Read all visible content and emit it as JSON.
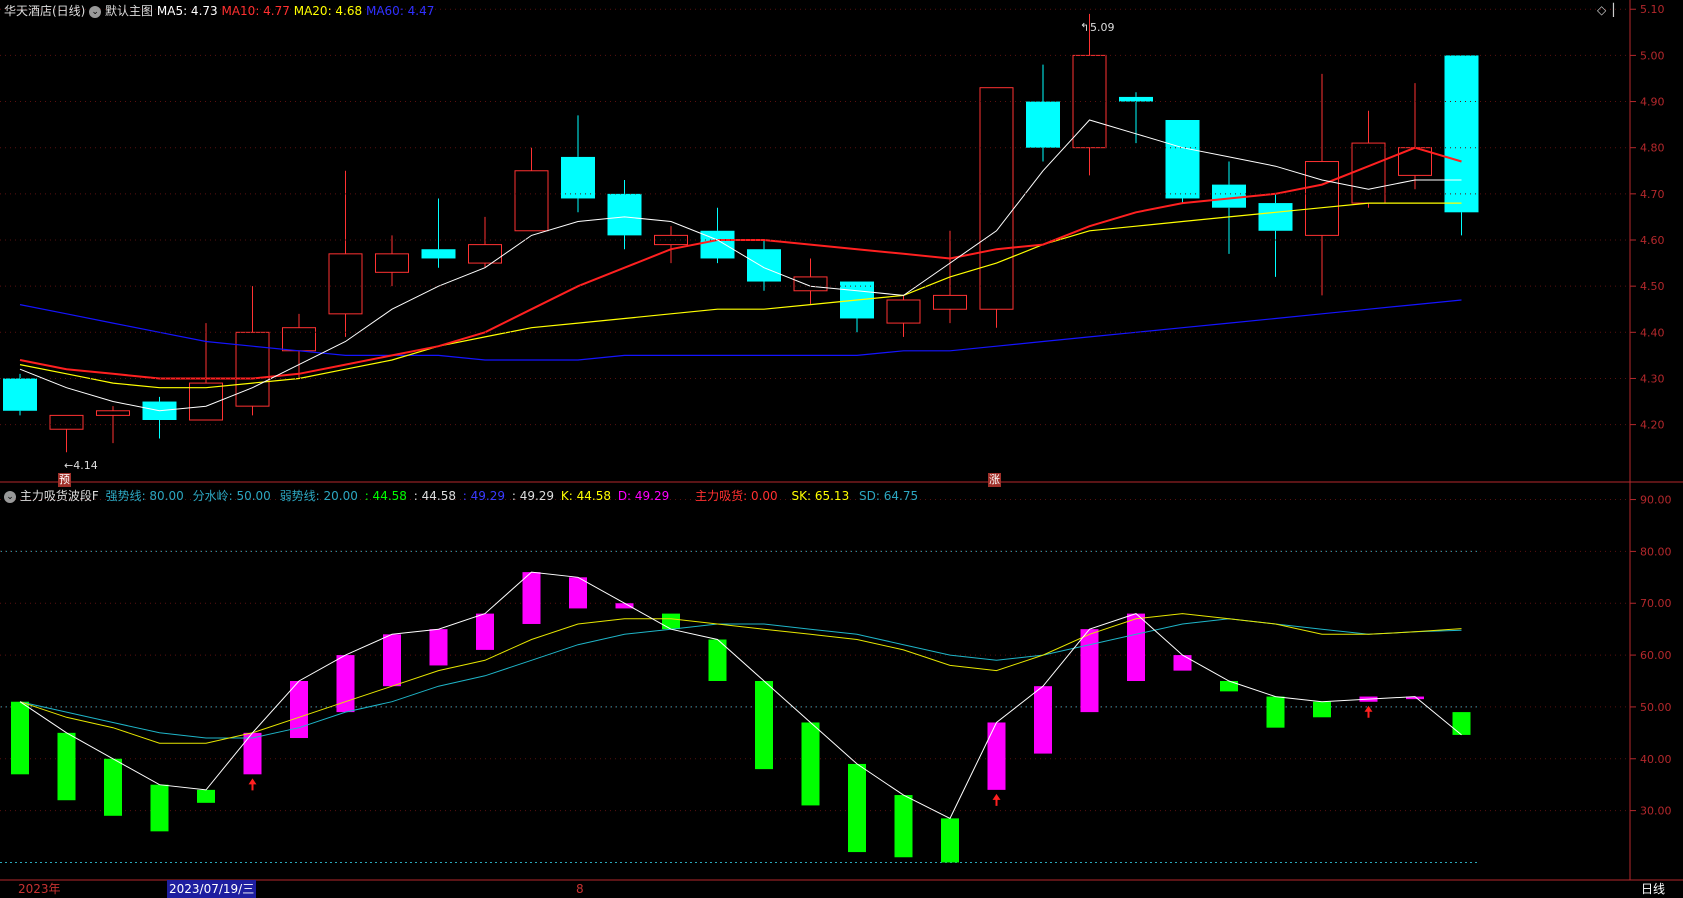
{
  "header_main": {
    "stock_name": "华天酒店(日线)",
    "indicator_name": "默认主图",
    "ma5": "MA5: 4.73",
    "ma10": "MA10: 4.77",
    "ma20": "MA20: 4.68",
    "ma60": "MA60: 4.47"
  },
  "header_sub": {
    "indicator_name": "主力吸货波段F",
    "strong_line": "强势线: 80.00",
    "water_line": "分水岭: 50.00",
    "weak_line": "弱势线: 20.00",
    "v1": ": 44.58",
    "v2": ": 44.58",
    "v3": ": 49.29",
    "v4": ": 49.29",
    "k": "K: 44.58",
    "d": "D: 49.29",
    "absorb": "主力吸货: 0.00",
    "sk": "SK: 65.13",
    "sd": "SD: 64.75"
  },
  "annotations": {
    "high": "5.09",
    "low": "←4.14",
    "pre_badge": "预",
    "rise_badge": "涨",
    "high_mark": "↰"
  },
  "bottom_bar": {
    "year": "2023年",
    "date": "2023/07/19/三",
    "mid_marker": "8",
    "period": "日线"
  },
  "icons": {
    "header_toggle": "chevron-down-icon",
    "settings": "diamond-icon"
  },
  "colors": {
    "up": "#ff3232",
    "down": "#00ffff",
    "ma5": "#ffffff",
    "ma10": "#ff2020",
    "ma20": "#ffff00",
    "ma60": "#1414ff",
    "kd_up": "#ff00ff",
    "kd_down": "#00ff00",
    "axis": "#b4282c",
    "sk": "#e6e600",
    "sd": "#1fb5c8"
  },
  "chart_data": [
    {
      "type": "candlestick",
      "title": "华天酒店(日线)",
      "y_ticks": [
        "5.10",
        "5.00",
        "4.90",
        "4.80",
        "4.70",
        "4.60",
        "4.50",
        "4.40",
        "4.30",
        "4.20"
      ],
      "ylim": [
        4.08,
        5.12
      ],
      "candles": [
        {
          "o": 4.3,
          "h": 4.31,
          "l": 4.22,
          "c": 4.23
        },
        {
          "o": 4.19,
          "h": 4.22,
          "l": 4.14,
          "c": 4.22
        },
        {
          "o": 4.22,
          "h": 4.24,
          "l": 4.16,
          "c": 4.23
        },
        {
          "o": 4.25,
          "h": 4.26,
          "l": 4.17,
          "c": 4.21
        },
        {
          "o": 4.21,
          "h": 4.42,
          "l": 4.21,
          "c": 4.29
        },
        {
          "o": 4.24,
          "h": 4.5,
          "l": 4.22,
          "c": 4.4
        },
        {
          "o": 4.36,
          "h": 4.44,
          "l": 4.3,
          "c": 4.41
        },
        {
          "o": 4.44,
          "h": 4.75,
          "l": 4.39,
          "c": 4.57
        },
        {
          "o": 4.53,
          "h": 4.61,
          "l": 4.5,
          "c": 4.57
        },
        {
          "o": 4.58,
          "h": 4.69,
          "l": 4.54,
          "c": 4.56
        },
        {
          "o": 4.55,
          "h": 4.65,
          "l": 4.54,
          "c": 4.59
        },
        {
          "o": 4.62,
          "h": 4.8,
          "l": 4.62,
          "c": 4.75
        },
        {
          "o": 4.78,
          "h": 4.87,
          "l": 4.66,
          "c": 4.69
        },
        {
          "o": 4.7,
          "h": 4.73,
          "l": 4.58,
          "c": 4.61
        },
        {
          "o": 4.59,
          "h": 4.63,
          "l": 4.55,
          "c": 4.61
        },
        {
          "o": 4.62,
          "h": 4.67,
          "l": 4.55,
          "c": 4.56
        },
        {
          "o": 4.58,
          "h": 4.6,
          "l": 4.49,
          "c": 4.51
        },
        {
          "o": 4.49,
          "h": 4.56,
          "l": 4.46,
          "c": 4.52
        },
        {
          "o": 4.51,
          "h": 4.51,
          "l": 4.4,
          "c": 4.43
        },
        {
          "o": 4.42,
          "h": 4.48,
          "l": 4.39,
          "c": 4.47
        },
        {
          "o": 4.45,
          "h": 4.62,
          "l": 4.42,
          "c": 4.48
        },
        {
          "o": 4.45,
          "h": 4.93,
          "l": 4.41,
          "c": 4.93
        },
        {
          "o": 4.9,
          "h": 4.98,
          "l": 4.77,
          "c": 4.8
        },
        {
          "o": 4.8,
          "h": 5.09,
          "l": 4.74,
          "c": 5.0
        },
        {
          "o": 4.91,
          "h": 4.92,
          "l": 4.81,
          "c": 4.9
        },
        {
          "o": 4.86,
          "h": 4.86,
          "l": 4.68,
          "c": 4.69
        },
        {
          "o": 4.72,
          "h": 4.77,
          "l": 4.57,
          "c": 4.67
        },
        {
          "o": 4.68,
          "h": 4.7,
          "l": 4.52,
          "c": 4.62
        },
        {
          "o": 4.61,
          "h": 4.96,
          "l": 4.48,
          "c": 4.77
        },
        {
          "o": 4.68,
          "h": 4.88,
          "l": 4.67,
          "c": 4.81
        },
        {
          "o": 4.74,
          "h": 4.94,
          "l": 4.71,
          "c": 4.8
        },
        {
          "o": 5.0,
          "h": 5.0,
          "l": 4.61,
          "c": 4.66
        }
      ],
      "ma5": [
        4.32,
        4.28,
        4.25,
        4.23,
        4.24,
        4.28,
        4.33,
        4.38,
        4.45,
        4.5,
        4.54,
        4.61,
        4.64,
        4.65,
        4.64,
        4.6,
        4.54,
        4.5,
        4.49,
        4.48,
        4.55,
        4.62,
        4.75,
        4.86,
        4.83,
        4.8,
        4.78,
        4.76,
        4.73,
        4.71,
        4.73,
        4.73
      ],
      "ma10": [
        4.34,
        4.32,
        4.31,
        4.3,
        4.3,
        4.3,
        4.31,
        4.33,
        4.35,
        4.37,
        4.4,
        4.45,
        4.5,
        4.54,
        4.58,
        4.6,
        4.6,
        4.59,
        4.58,
        4.57,
        4.56,
        4.58,
        4.59,
        4.63,
        4.66,
        4.68,
        4.69,
        4.7,
        4.72,
        4.76,
        4.8,
        4.77
      ],
      "ma20": [
        4.33,
        4.31,
        4.29,
        4.28,
        4.28,
        4.29,
        4.3,
        4.32,
        4.34,
        4.37,
        4.39,
        4.41,
        4.42,
        4.43,
        4.44,
        4.45,
        4.45,
        4.46,
        4.47,
        4.48,
        4.52,
        4.55,
        4.59,
        4.62,
        4.63,
        4.64,
        4.65,
        4.66,
        4.67,
        4.68,
        4.68,
        4.68
      ],
      "ma60": [
        4.46,
        4.44,
        4.42,
        4.4,
        4.38,
        4.37,
        4.36,
        4.35,
        4.35,
        4.35,
        4.34,
        4.34,
        4.34,
        4.35,
        4.35,
        4.35,
        4.35,
        4.35,
        4.35,
        4.36,
        4.36,
        4.37,
        4.38,
        4.39,
        4.4,
        4.41,
        4.42,
        4.43,
        4.44,
        4.45,
        4.46,
        4.47
      ]
    },
    {
      "type": "bar",
      "title": "主力吸货波段F",
      "y_ticks": [
        "90.00",
        "80.00",
        "70.00",
        "60.00",
        "50.00",
        "40.00",
        "30.00"
      ],
      "ylim": [
        17,
        93
      ],
      "reference_lines": [
        80,
        50,
        20
      ],
      "bars": [
        {
          "from": 51,
          "to": 37
        },
        {
          "from": 45,
          "to": 32
        },
        {
          "from": 40,
          "to": 29
        },
        {
          "from": 35,
          "to": 26
        },
        {
          "from": 34,
          "to": 31.5
        },
        {
          "from": 37,
          "to": 45
        },
        {
          "from": 44,
          "to": 55
        },
        {
          "from": 49,
          "to": 60
        },
        {
          "from": 54,
          "to": 64
        },
        {
          "from": 58,
          "to": 65
        },
        {
          "from": 61,
          "to": 68
        },
        {
          "from": 66,
          "to": 76
        },
        {
          "from": 69,
          "to": 75
        },
        {
          "from": 69,
          "to": 70
        },
        {
          "from": 68,
          "to": 65
        },
        {
          "from": 63,
          "to": 55
        },
        {
          "from": 55,
          "to": 38
        },
        {
          "from": 47,
          "to": 31
        },
        {
          "from": 39,
          "to": 22
        },
        {
          "from": 33,
          "to": 21
        },
        {
          "from": 28.5,
          "to": 20
        },
        {
          "from": 34,
          "to": 47
        },
        {
          "from": 41,
          "to": 54
        },
        {
          "from": 49,
          "to": 65
        },
        {
          "from": 55,
          "to": 68
        },
        {
          "from": 57,
          "to": 60
        },
        {
          "from": 55,
          "to": 53
        },
        {
          "from": 52,
          "to": 46
        },
        {
          "from": 51,
          "to": 48
        },
        {
          "from": 51,
          "to": 52
        },
        {
          "from": 51.5,
          "to": 52
        },
        {
          "from": 49,
          "to": 44.6
        }
      ],
      "k": [
        51,
        45,
        40,
        35,
        34,
        45,
        55,
        60,
        64,
        65,
        68,
        76,
        75,
        70,
        65,
        63,
        55,
        47,
        39,
        33,
        28.5,
        47,
        54,
        65,
        68,
        60,
        55,
        52,
        51,
        51.5,
        52,
        44.6
      ],
      "sk": [
        51,
        48,
        46,
        43,
        43,
        45,
        48,
        51,
        54,
        57,
        59,
        63,
        66,
        67,
        67,
        66,
        65,
        64,
        63,
        61,
        58,
        57,
        60,
        64,
        67,
        68,
        67,
        66,
        64,
        64,
        64.5,
        65.1
      ],
      "sd": [
        51,
        49,
        47,
        45,
        44,
        44,
        46,
        49,
        51,
        54,
        56,
        59,
        62,
        64,
        65,
        66,
        66,
        65,
        64,
        62,
        60,
        59,
        60,
        62,
        64,
        66,
        67,
        66,
        65,
        64,
        64.5,
        64.8
      ],
      "absorb_arrows": [
        5,
        21,
        29
      ]
    }
  ]
}
